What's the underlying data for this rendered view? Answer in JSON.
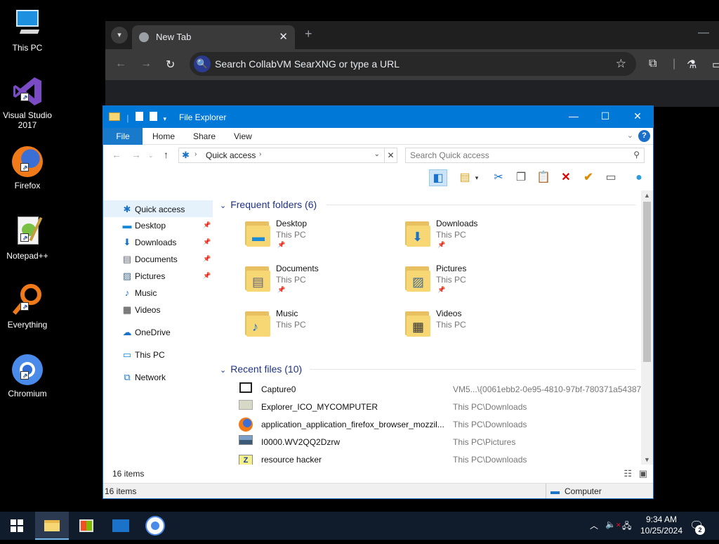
{
  "desktop": {
    "icons": [
      {
        "label": "This PC",
        "icon": "this-pc-icon"
      },
      {
        "label": "Visual Studio 2017",
        "icon": "visual-studio-icon"
      },
      {
        "label": "Firefox",
        "icon": "firefox-icon"
      },
      {
        "label": "Notepad++",
        "icon": "notepadpp-icon"
      },
      {
        "label": "Everything",
        "icon": "everything-icon"
      },
      {
        "label": "Chromium",
        "icon": "chromium-icon"
      }
    ]
  },
  "browser": {
    "tab_title": "New Tab",
    "omnibox_placeholder": "Search CollabVM SearXNG or type a URL"
  },
  "explorer": {
    "title": "File Explorer",
    "ribbon_tabs": {
      "file": "File",
      "home": "Home",
      "share": "Share",
      "view": "View"
    },
    "address": "Quick access",
    "search_placeholder": "Search Quick access",
    "nav": [
      {
        "label": "Quick access",
        "icon": "star-icon",
        "pinned": false
      },
      {
        "label": "Desktop",
        "icon": "desktop-icon",
        "pinned": true
      },
      {
        "label": "Downloads",
        "icon": "download-icon",
        "pinned": true
      },
      {
        "label": "Documents",
        "icon": "document-icon",
        "pinned": true
      },
      {
        "label": "Pictures",
        "icon": "picture-icon",
        "pinned": true
      },
      {
        "label": "Music",
        "icon": "music-icon",
        "pinned": false
      },
      {
        "label": "Videos",
        "icon": "video-icon",
        "pinned": false
      },
      {
        "label": "OneDrive",
        "icon": "cloud-icon",
        "pinned": false
      },
      {
        "label": "This PC",
        "icon": "computer-icon",
        "pinned": false
      },
      {
        "label": "Network",
        "icon": "network-icon",
        "pinned": false
      }
    ],
    "frequent_header": "Frequent folders (6)",
    "folders": [
      {
        "name": "Desktop",
        "location": "This PC",
        "pinned": true
      },
      {
        "name": "Downloads",
        "location": "This PC",
        "pinned": true
      },
      {
        "name": "Documents",
        "location": "This PC",
        "pinned": true
      },
      {
        "name": "Pictures",
        "location": "This PC",
        "pinned": true
      },
      {
        "name": "Music",
        "location": "This PC",
        "pinned": false
      },
      {
        "name": "Videos",
        "location": "This PC",
        "pinned": false
      }
    ],
    "recent_header": "Recent files (10)",
    "recent": [
      {
        "name": "Capture0",
        "path": "VM5...\\{0061ebb2-0e95-4810-97bf-780371a54387}"
      },
      {
        "name": "Explorer_ICO_MYCOMPUTER",
        "path": "This PC\\Downloads"
      },
      {
        "name": "application_application_firefox_browser_mozzil...",
        "path": "This PC\\Downloads"
      },
      {
        "name": "I0000.WV2QQ2Dzrw",
        "path": "This PC\\Pictures"
      },
      {
        "name": "resource hacker",
        "path": "This PC\\Downloads"
      }
    ],
    "item_count": "16 items",
    "status_count": "16 items",
    "status_location": "Computer"
  },
  "taskbar": {
    "time": "9:34 AM",
    "date": "10/25/2024",
    "notifications": "2"
  }
}
